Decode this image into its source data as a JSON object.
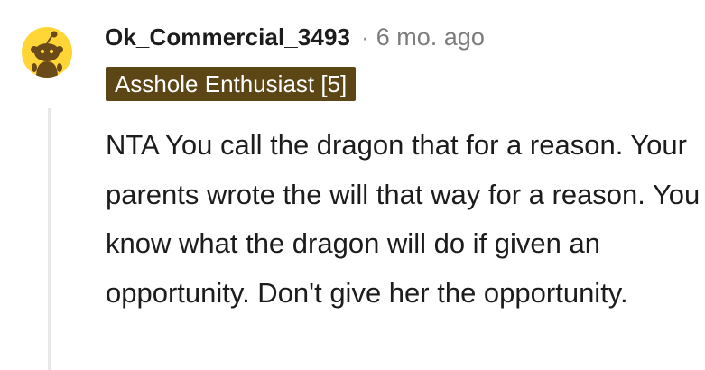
{
  "comment": {
    "author": "Ok_Commercial_3493",
    "separator": "·",
    "timestamp": "6 mo. ago",
    "flair": "Asshole Enthusiast [5]",
    "body": "NTA You call the dragon that for a reason. Your parents wrote the will that way for a reason. You know what the dragon will do if given an opportunity. Don't give her the opportunity.",
    "avatar_icon": "snoo-avatar-icon"
  },
  "colors": {
    "avatar_background": "#ffd635",
    "flair_background": "#5c4616",
    "flair_text": "#ffffff",
    "thread_line": "#e8e8e8",
    "meta_text": "#7c7c7c"
  }
}
